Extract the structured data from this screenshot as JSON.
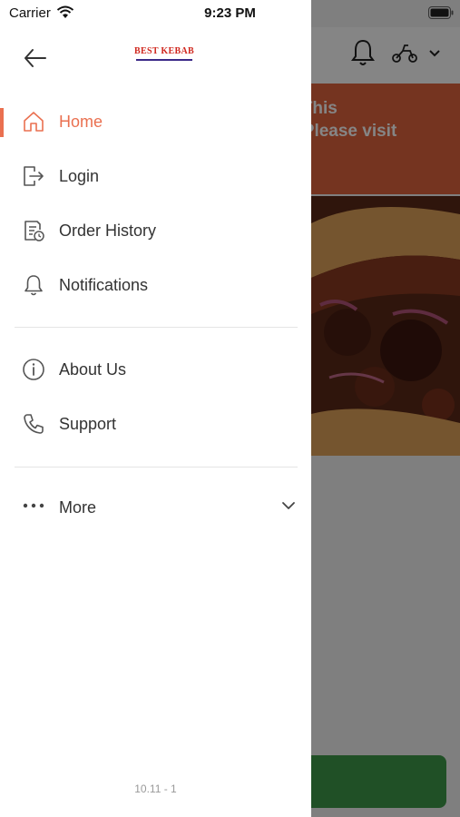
{
  "status_bar": {
    "carrier": "Carrier",
    "time": "9:23 PM"
  },
  "background": {
    "banner_text": "ed, This\non. Please visit\n,",
    "banner_color": "#e0643f",
    "order_button_color": "#3f9a4a"
  },
  "drawer": {
    "logo_text": "BEST KEBAB",
    "accent_color": "#ea7050",
    "menu_primary": [
      {
        "label": "Home",
        "icon": "home-icon",
        "active": true
      },
      {
        "label": "Login",
        "icon": "login-icon",
        "active": false
      },
      {
        "label": "Order History",
        "icon": "order-history-icon",
        "active": false
      },
      {
        "label": "Notifications",
        "icon": "bell-icon",
        "active": false
      }
    ],
    "menu_secondary": [
      {
        "label": "About Us",
        "icon": "info-icon"
      },
      {
        "label": "Support",
        "icon": "phone-icon"
      }
    ],
    "more": {
      "label": "More",
      "icon": "more-dots-icon"
    },
    "version": "10.11 - 1"
  }
}
